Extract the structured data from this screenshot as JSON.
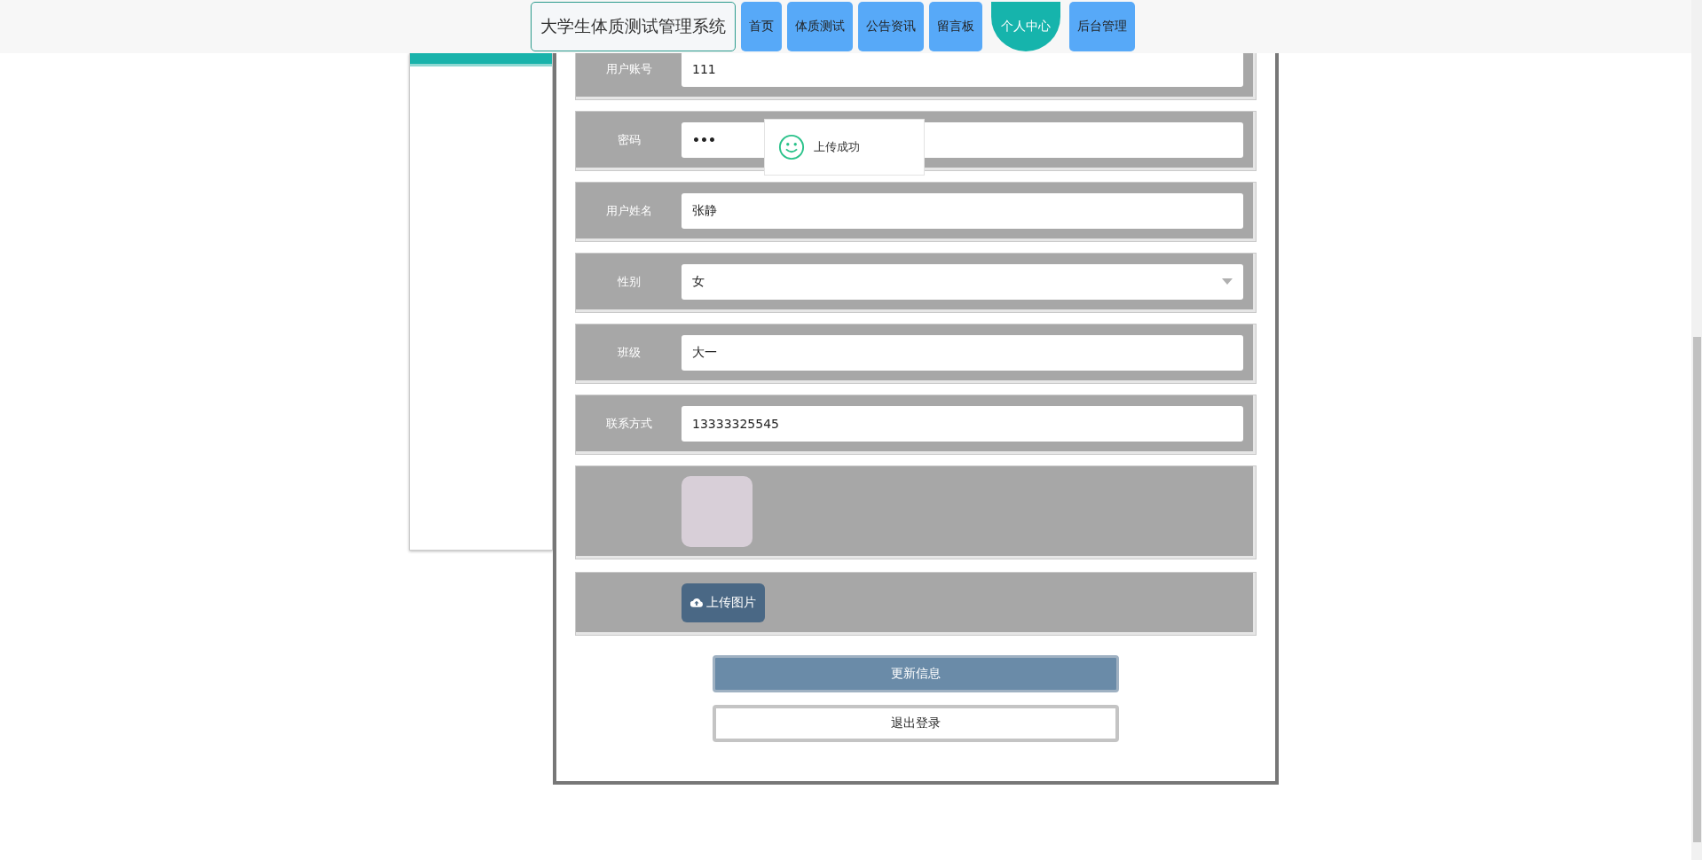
{
  "header": {
    "title": "大学生体质测试管理系统",
    "nav": [
      {
        "label": "首页",
        "selected": false
      },
      {
        "label": "体质测试",
        "selected": false
      },
      {
        "label": "公告资讯",
        "selected": false
      },
      {
        "label": "留言板",
        "selected": false
      },
      {
        "label": "个人中心",
        "selected": true
      },
      {
        "label": "后台管理",
        "selected": false
      }
    ]
  },
  "form": {
    "fields": [
      {
        "label": "用户账号",
        "kind": "text",
        "value": "111"
      },
      {
        "label": "密码",
        "kind": "password",
        "value": "•••"
      },
      {
        "label": "用户姓名",
        "kind": "text",
        "value": "张静"
      },
      {
        "label": "性别",
        "kind": "select",
        "value": "女"
      },
      {
        "label": "班级",
        "kind": "text",
        "value": "大一"
      },
      {
        "label": "联系方式",
        "kind": "text",
        "value": "13333325545"
      }
    ],
    "upload_button": "上传图片",
    "submit_button": "更新信息",
    "logout_button": "退出登录"
  },
  "toast": {
    "message": "上传成功"
  }
}
